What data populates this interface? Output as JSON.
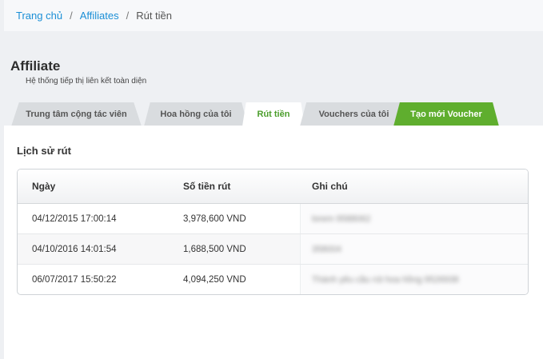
{
  "breadcrumb": {
    "home": "Trang chủ",
    "affiliates": "Affiliates",
    "current": "Rút tiền",
    "separator": "/"
  },
  "header": {
    "title": "Affiliate",
    "subtitle": "Hệ thống tiếp thị liên kết toàn diện"
  },
  "tabs": [
    {
      "label": "Trung tâm cộng tác viên",
      "active": false
    },
    {
      "label": "Hoa hồng của tôi",
      "active": false
    },
    {
      "label": "Rút tiền",
      "active": true
    },
    {
      "label": "Vouchers của tôi",
      "active": false
    },
    {
      "label": "Tạo mới Voucher",
      "active": false,
      "color": "#5fae2e"
    }
  ],
  "history": {
    "title": "Lịch sử rút",
    "columns": [
      "Ngày",
      "Số tiền rút",
      "Ghi chú"
    ],
    "rows": [
      {
        "date": "04/12/2015 17:00:14",
        "amount": "3,978,600 VND",
        "note": "lorem 9588062"
      },
      {
        "date": "04/10/2016 14:01:54",
        "amount": "1,688,500 VND",
        "note": "358004"
      },
      {
        "date": "06/07/2017 15:50:22",
        "amount": "4,094,250 VND",
        "note": "Thành yêu cầu rút hoa hồng 9526938"
      }
    ]
  },
  "colors": {
    "link": "#1b8fd6",
    "active_tab_text": "#4a9d2a",
    "voucher_tab_bg": "#5fae2e"
  }
}
